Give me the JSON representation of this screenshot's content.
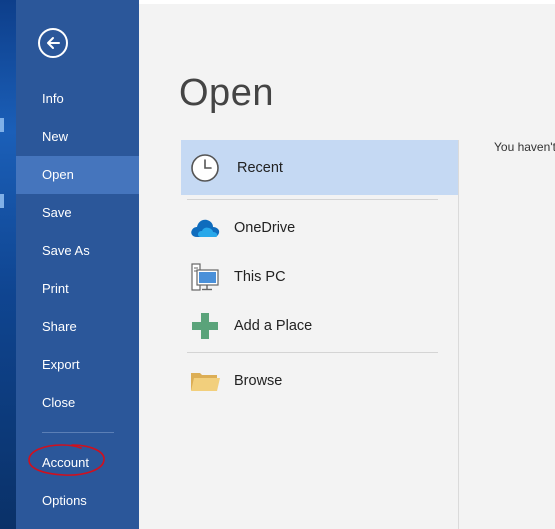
{
  "sidebar": {
    "items": [
      {
        "id": "info",
        "label": "Info"
      },
      {
        "id": "new",
        "label": "New"
      },
      {
        "id": "open",
        "label": "Open",
        "selected": true
      },
      {
        "id": "save",
        "label": "Save"
      },
      {
        "id": "save-as",
        "label": "Save As"
      },
      {
        "id": "print",
        "label": "Print"
      },
      {
        "id": "share",
        "label": "Share"
      },
      {
        "id": "export",
        "label": "Export"
      },
      {
        "id": "close",
        "label": "Close"
      }
    ],
    "bottom_items": [
      {
        "id": "account",
        "label": "Account",
        "highlight_annotation": "red-hand-drawn-circle"
      },
      {
        "id": "options",
        "label": "Options"
      }
    ],
    "back_icon": "back-arrow-icon"
  },
  "main": {
    "title": "Open",
    "places": [
      {
        "id": "recent",
        "label": "Recent",
        "icon": "clock-icon",
        "selected": true
      },
      {
        "id": "onedrive",
        "label": "OneDrive",
        "icon": "cloud-icon"
      },
      {
        "id": "this-pc",
        "label": "This PC",
        "icon": "computer-icon"
      },
      {
        "id": "add-place",
        "label": "Add a Place",
        "icon": "plus-icon"
      },
      {
        "id": "browse",
        "label": "Browse",
        "icon": "folder-icon"
      }
    ],
    "recent_message": "You haven't"
  },
  "colors": {
    "sidebar_bg": "#2b579a",
    "sidebar_selected": "#4575bd",
    "place_selected": "#c5d9f3",
    "annotation": "#d0101e"
  }
}
